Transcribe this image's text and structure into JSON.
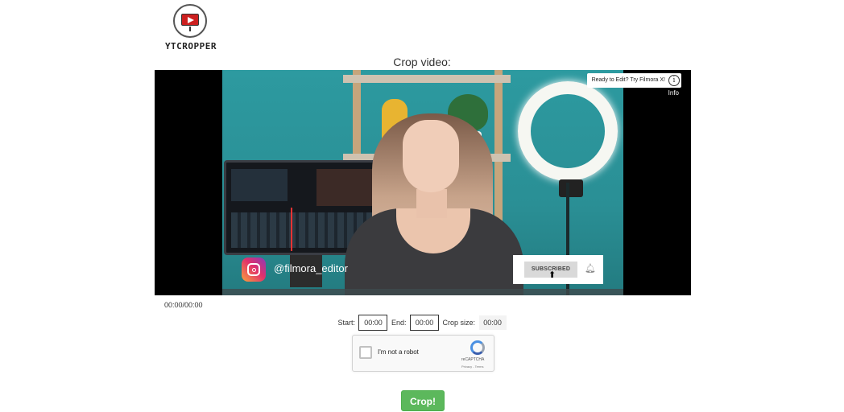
{
  "app": {
    "logo_text": "YTCROPPER"
  },
  "crop_heading": "Crop video:",
  "video": {
    "info_banner": "Ready to Edit? Try Filmora X!",
    "info_label": "Info",
    "instagram_handle": "@filmora_editor",
    "subscribed_label": "SUBSCRIBED",
    "time_display": "00:00/00:00"
  },
  "controls": {
    "start_label": "Start:",
    "start_value": "00:00",
    "end_label": "End:",
    "end_value": "00:00",
    "crop_size_label": "Crop size:",
    "crop_size_value": "00:00"
  },
  "recaptcha": {
    "label": "I'm not a robot",
    "brand": "reCAPTCHA",
    "privacy": "Privacy - Terms"
  },
  "crop_button": "Crop!",
  "colors": {
    "crop_button": "#5cb85c",
    "video_bg": "#000000"
  }
}
